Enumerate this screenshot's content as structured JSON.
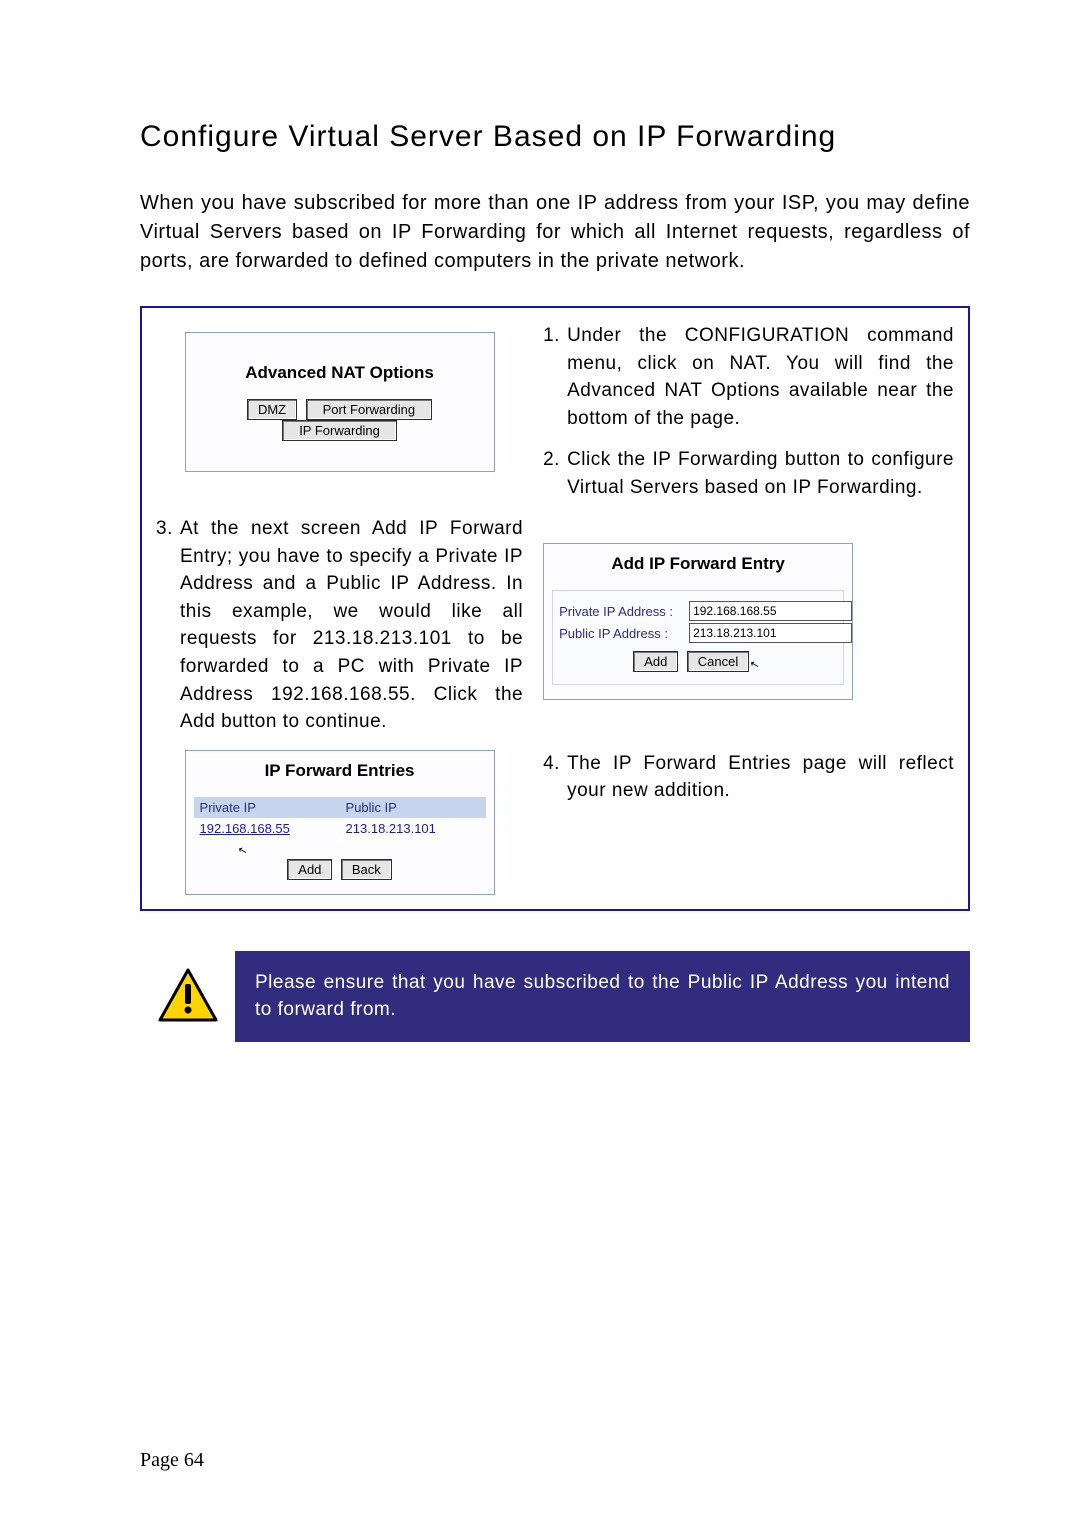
{
  "title": "Configure Virtual Server Based on IP Forwarding",
  "intro": "When you have subscribed for more than one IP address from your ISP, you may define Virtual Servers based on IP Forwarding for which all Internet requests, regardless of ports, are forwarded to defined computers in the private network.",
  "steps": {
    "s1": "Under the CONFIGURATION command menu, click on NAT. You will find the Advanced NAT Options available near the bottom of the page.",
    "s2": "Click the IP Forwarding button to configure Virtual Servers based on IP Forwarding.",
    "s3": "At the next screen Add IP Forward Entry; you have to specify a Private IP Address and a Public IP Address. In this example, we would like all requests for 213.18.213.101 to be forwarded to a PC with Private IP Address 192.168.168.55. Click the Add button to continue.",
    "s4": "The IP Forward Entries page will reflect your new addition."
  },
  "nat_options": {
    "title": "Advanced NAT Options",
    "buttons": {
      "dmz": "DMZ",
      "port_forwarding": "Port Forwarding",
      "ip_forwarding": "IP Forwarding"
    }
  },
  "add_entry": {
    "title": "Add IP Forward Entry",
    "private_label": "Private IP Address  :",
    "public_label": "Public IP Address  :",
    "private_value": "192.168.168.55",
    "public_value": "213.18.213.101",
    "buttons": {
      "add": "Add",
      "cancel": "Cancel"
    }
  },
  "entries": {
    "title": "IP Forward Entries",
    "headers": {
      "private": "Private IP",
      "public": "Public IP"
    },
    "private_value": "192.168.168.55",
    "public_value": "213.18.213.101",
    "buttons": {
      "add": "Add",
      "back": "Back"
    }
  },
  "warning": "Please ensure that you have subscribed to the Public IP Address you intend to forward from.",
  "page_number": "Page 64"
}
